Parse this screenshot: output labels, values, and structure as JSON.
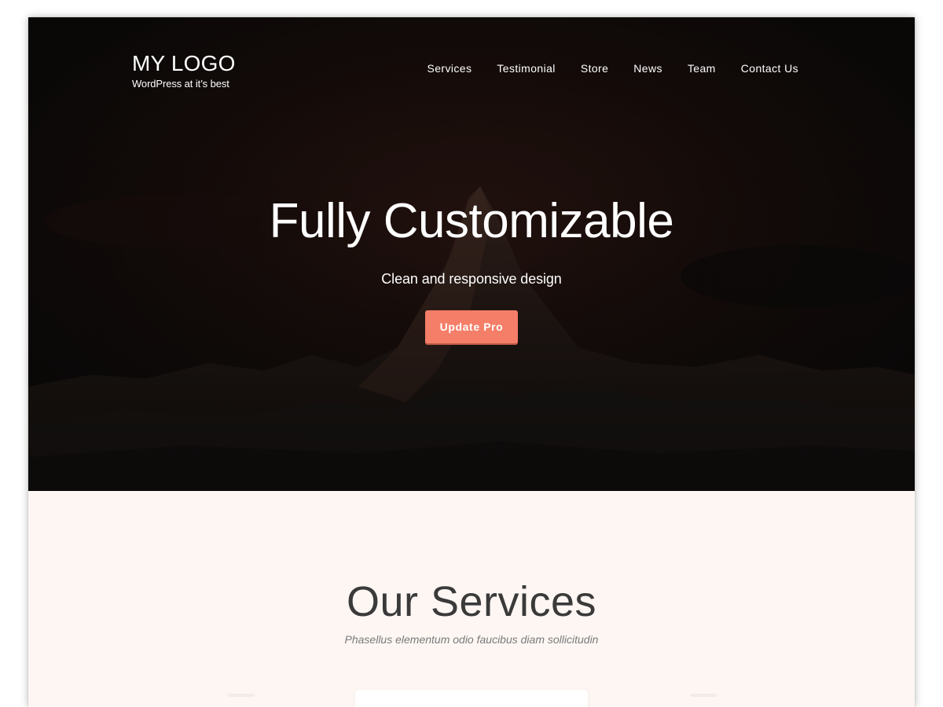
{
  "header": {
    "logo_title": "MY LOGO",
    "logo_tagline": "WordPress at it’s best",
    "nav": [
      {
        "label": "Services"
      },
      {
        "label": "Testimonial"
      },
      {
        "label": "Store"
      },
      {
        "label": "News"
      },
      {
        "label": "Team"
      },
      {
        "label": "Contact Us"
      }
    ]
  },
  "hero": {
    "title": "Fully Customizable",
    "subtitle": "Clean and responsive design",
    "button_label": "Update Pro"
  },
  "services": {
    "title": "Our Services",
    "subtitle": "Phasellus elementum odio faucibus diam sollicitudin"
  },
  "colors": {
    "accent": "#f47e68",
    "hero_overlay": "#090807",
    "section_background": "#fdf6f3",
    "heading_text": "#3a3a3a",
    "muted_text": "#7a7a7a"
  }
}
